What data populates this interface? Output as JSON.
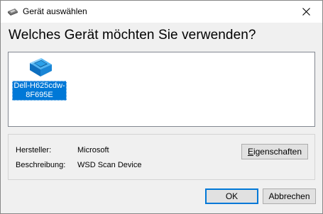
{
  "window": {
    "title": "Gerät auswählen",
    "close_glyph": "close-icon"
  },
  "heading": "Welches Gerät möchten Sie verwenden?",
  "devices": [
    {
      "name_line1": "Dell-H625cdw-",
      "name_line2": "8F695E",
      "icon": "scanner-icon",
      "selected": true
    }
  ],
  "info": {
    "manufacturer_label": "Hersteller:",
    "manufacturer_value": "Microsoft",
    "description_label": "Beschreibung:",
    "description_value": "WSD Scan Device",
    "properties_button_first": "E",
    "properties_button_rest": "igenschaften"
  },
  "buttons": {
    "ok": "OK",
    "cancel": "Abbrechen"
  },
  "colors": {
    "selection": "#0078d7",
    "scanner_body": "#1e8fe0"
  }
}
